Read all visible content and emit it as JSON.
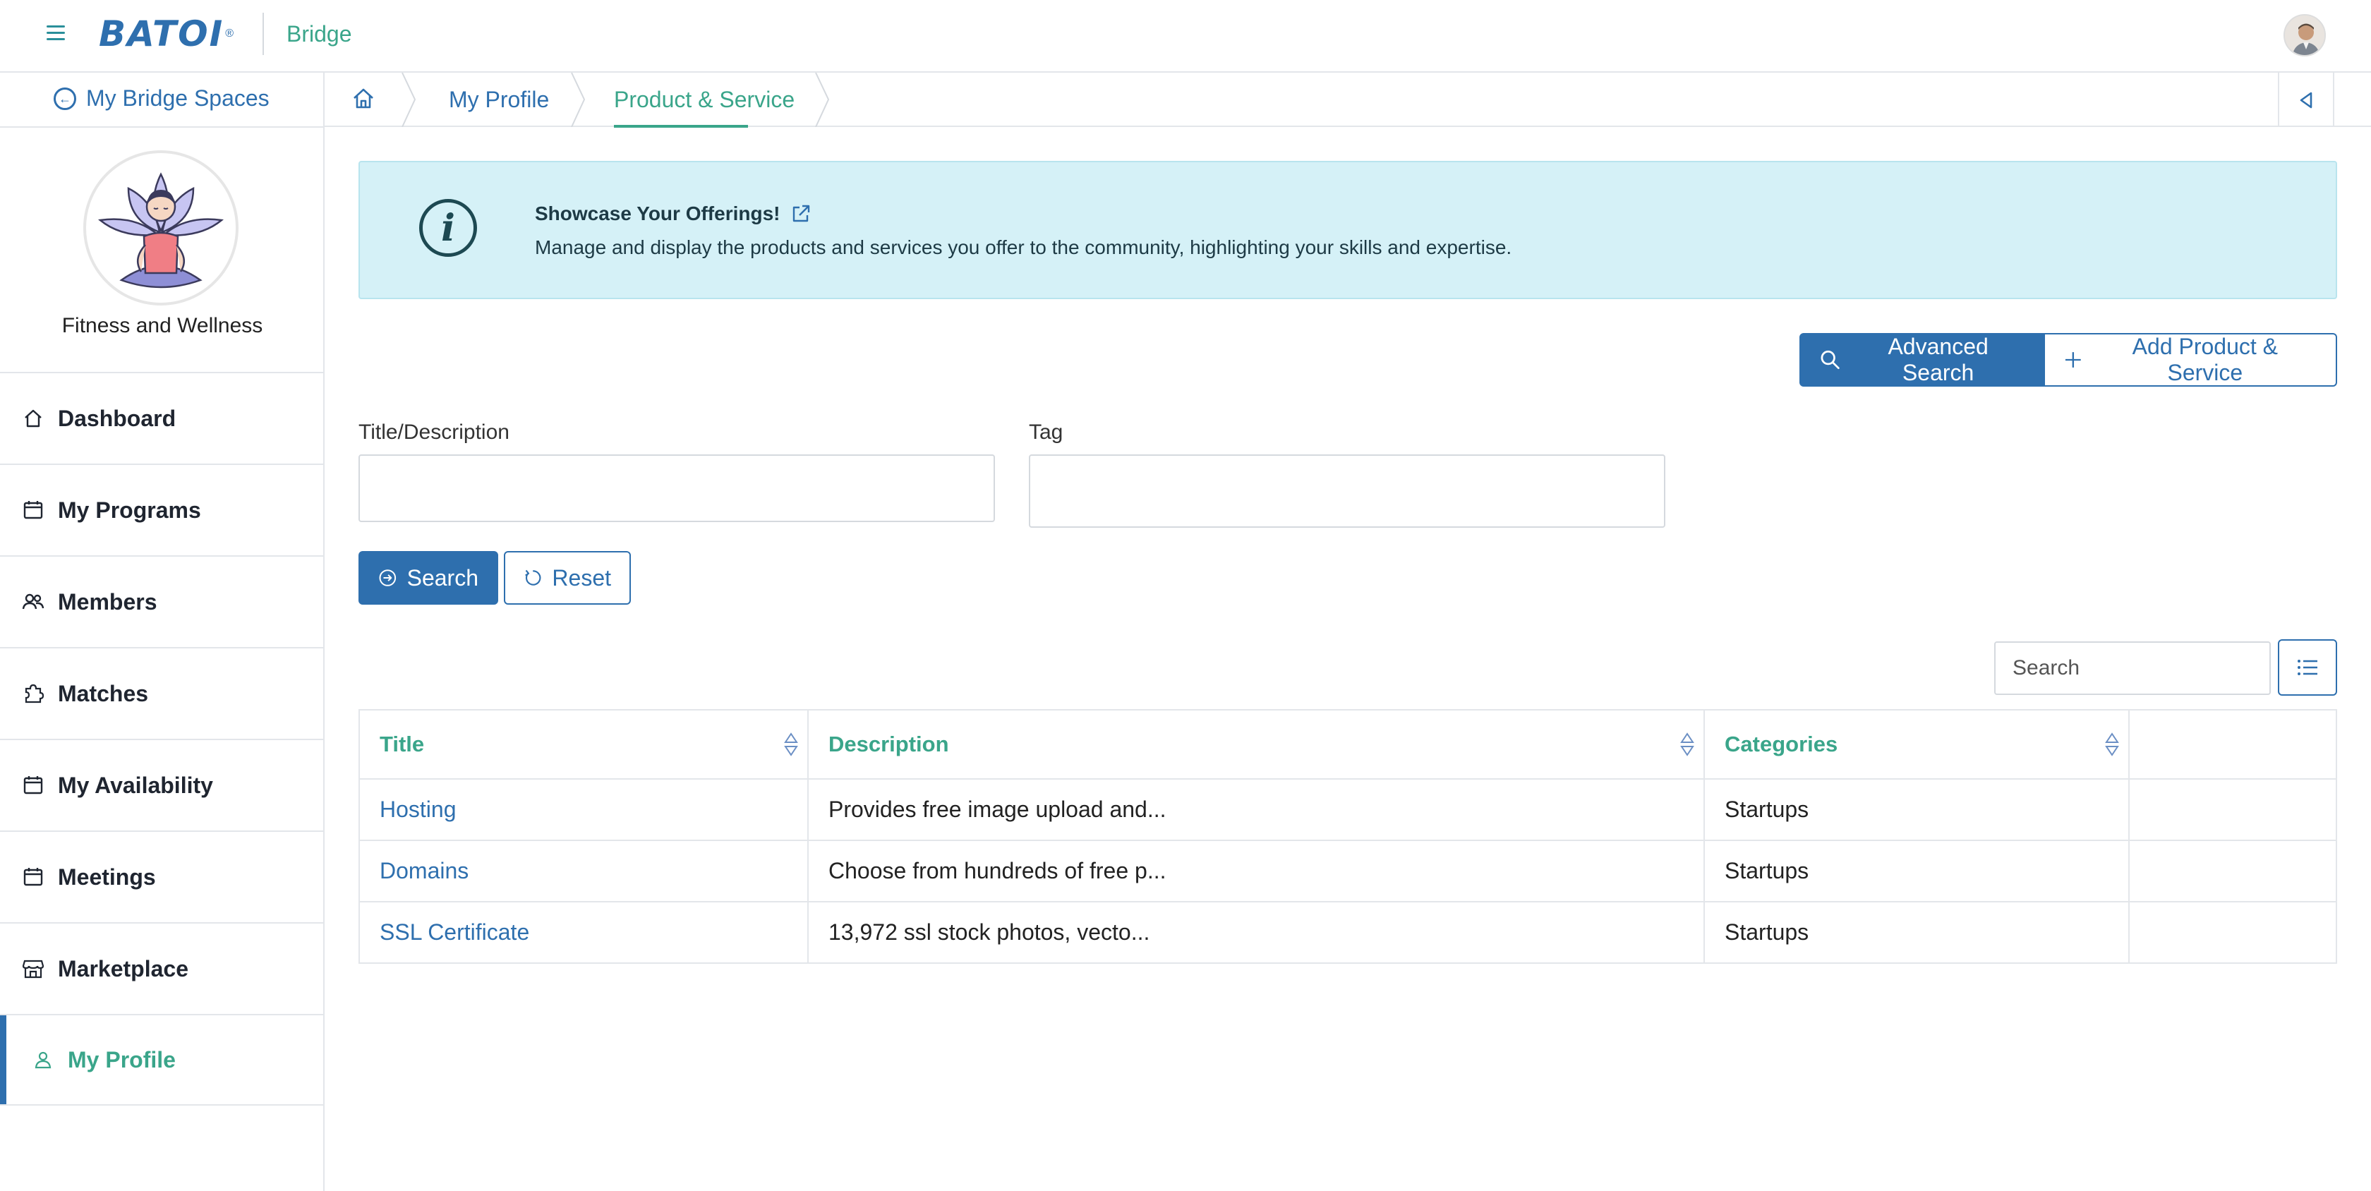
{
  "header": {
    "logo_text": "BATOI",
    "logo_mark": "®",
    "app_name": "Bridge"
  },
  "sidebar": {
    "back_label": "My Bridge Spaces",
    "space_name": "Fitness and Wellness",
    "items": [
      {
        "label": "Dashboard",
        "icon": "home-icon"
      },
      {
        "label": "My Programs",
        "icon": "calendar-icon"
      },
      {
        "label": "Members",
        "icon": "users-icon"
      },
      {
        "label": "Matches",
        "icon": "puzzle-icon"
      },
      {
        "label": "My Availability",
        "icon": "calendar-icon"
      },
      {
        "label": "Meetings",
        "icon": "calendar-icon"
      },
      {
        "label": "Marketplace",
        "icon": "store-icon"
      },
      {
        "label": "My Profile",
        "icon": "user-icon",
        "active": true
      }
    ]
  },
  "breadcrumb": {
    "items": [
      "My Profile",
      "Product & Service"
    ]
  },
  "banner": {
    "title": "Showcase Your Offerings!",
    "description": "Manage and display the products and services you offer to the community, highlighting your skills and expertise."
  },
  "actions": {
    "advanced_search": "Advanced Search",
    "add_product": "Add Product & Service"
  },
  "filters": {
    "title_label": "Title/Description",
    "title_value": "",
    "tag_label": "Tag",
    "tag_value": "",
    "search_label": "Search",
    "reset_label": "Reset"
  },
  "table": {
    "search_placeholder": "Search",
    "columns": [
      "Title",
      "Description",
      "Categories",
      ""
    ],
    "rows": [
      {
        "title": "Hosting",
        "description": "Provides free image upload and...",
        "category": "Startups"
      },
      {
        "title": "Domains",
        "description": "Choose from hundreds of free p...",
        "category": "Startups"
      },
      {
        "title": "SSL Certificate",
        "description": "13,972 ssl stock photos, vecto...",
        "category": "Startups"
      }
    ]
  },
  "colors": {
    "primary": "#2e6fae",
    "accent": "#3aa58a",
    "banner_bg": "#d5f1f7"
  }
}
